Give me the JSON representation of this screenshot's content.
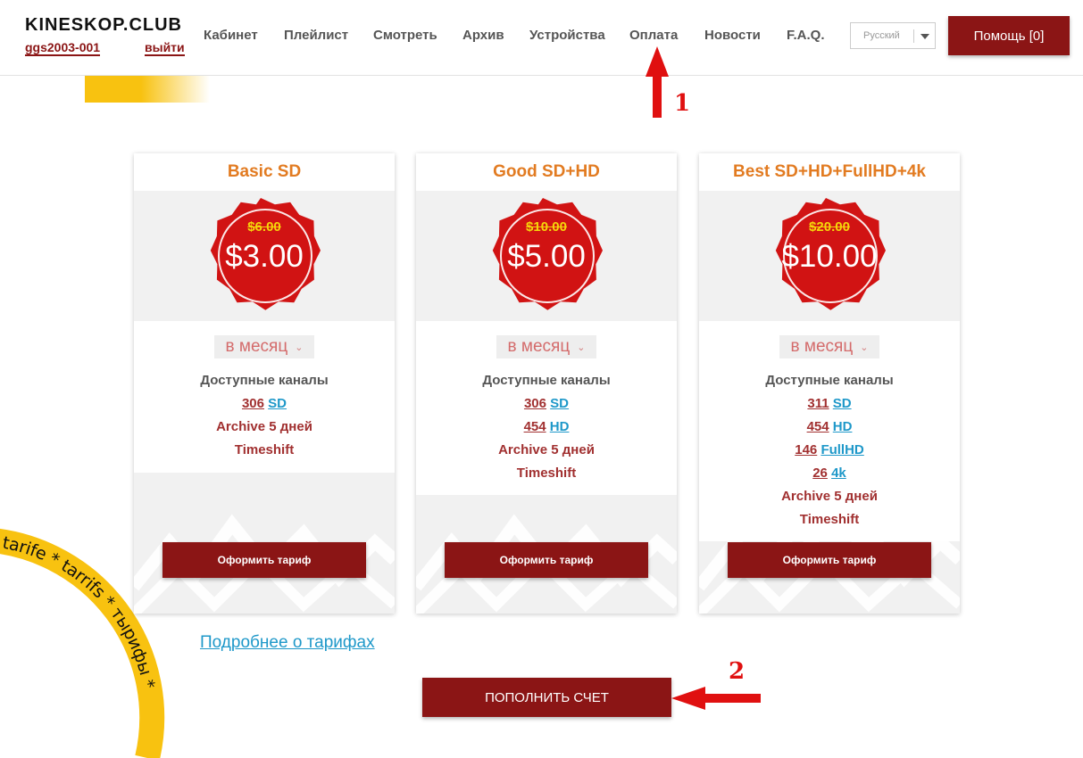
{
  "header": {
    "logo": "KINESKOP.CLUB",
    "username": "ggs2003-001",
    "logout": "выйти",
    "nav": [
      "Кабинет",
      "Плейлист",
      "Смотреть",
      "Архив",
      "Устройства",
      "Оплата",
      "Новости",
      "F.A.Q."
    ],
    "language": "Русский",
    "help": "Помощь [0]"
  },
  "annotations": {
    "arrow1": "1",
    "arrow2": "2"
  },
  "colors": {
    "brand_dark_red": "#8b1515",
    "title_orange": "#e27b21",
    "badge_red": "#d11313",
    "link_blue": "#1e98c9",
    "accent_yellow": "#f8c210"
  },
  "plans": [
    {
      "title": "Basic SD",
      "old_price": "$6.00",
      "price": "$3.00",
      "period": "в месяц",
      "channels_heading": "Доступные каналы",
      "channels": [
        {
          "count": "306",
          "type": "SD"
        }
      ],
      "archive": "Archive 5 дней",
      "timeshift": "Timeshift",
      "button": "Оформить тариф"
    },
    {
      "title": "Good SD+HD",
      "old_price": "$10.00",
      "price": "$5.00",
      "period": "в месяц",
      "channels_heading": "Доступные каналы",
      "channels": [
        {
          "count": "306",
          "type": "SD"
        },
        {
          "count": "454",
          "type": "HD"
        }
      ],
      "archive": "Archive 5 дней",
      "timeshift": "Timeshift",
      "button": "Оформить тариф"
    },
    {
      "title": "Best SD+HD+FullHD+4k",
      "old_price": "$20.00",
      "price": "$10.00",
      "period": "в месяц",
      "channels_heading": "Доступные каналы",
      "channels": [
        {
          "count": "311",
          "type": "SD"
        },
        {
          "count": "454",
          "type": "HD"
        },
        {
          "count": "146",
          "type": "FullHD"
        },
        {
          "count": "26",
          "type": "4k"
        }
      ],
      "archive": "Archive 5 дней",
      "timeshift": "Timeshift",
      "button": "Оформить тариф"
    }
  ],
  "more_link": "Подробнее о тарифах",
  "topup_button": "ПОПОЛНИТЬ СЧЕТ",
  "ribbon_text": "* tarife * tarrifs * тырифы *"
}
